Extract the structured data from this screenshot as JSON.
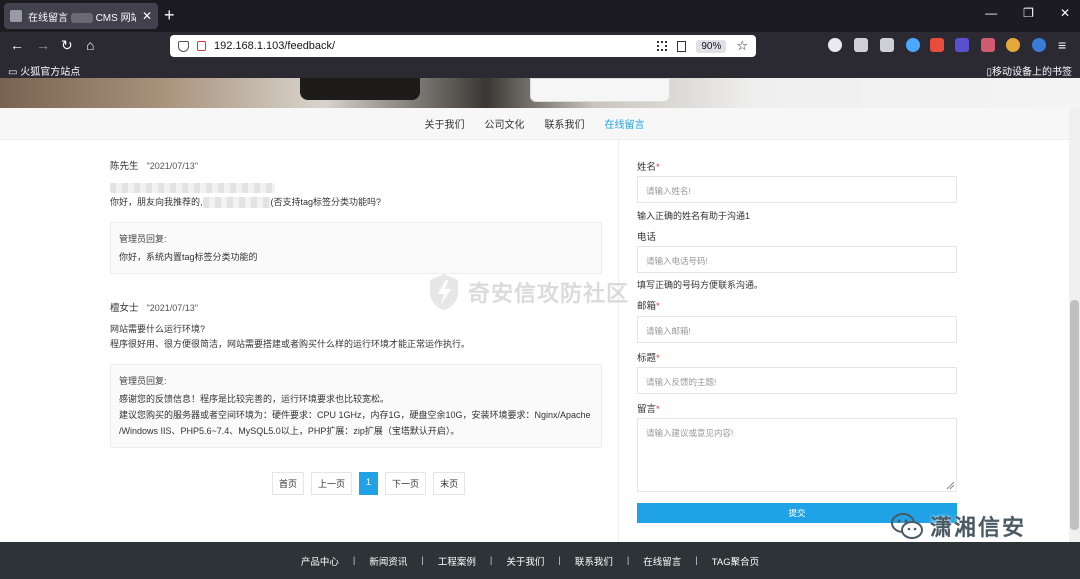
{
  "browser": {
    "tab_title": "在线留言",
    "tab_title_rest": "CMS 网站管理",
    "url": "192.168.1.103/feedback/",
    "zoom": "90%",
    "bookmark_left": "火狐官方站点",
    "bookmark_right": "移动设备上的书签"
  },
  "nav": {
    "items": [
      {
        "label": "关于我们"
      },
      {
        "label": "公司文化"
      },
      {
        "label": "联系我们"
      },
      {
        "label": "在线留言"
      }
    ],
    "active_color": "#1fa2e6"
  },
  "messages": [
    {
      "name": "陈先生",
      "date": "\"2021/07/13\"",
      "text_before": "你好，朋友向我推荐的,",
      "text_after": "(否支持tag标签分类功能吗?",
      "reply_label": "管理员回复:",
      "reply_lines": [
        "你好，系统内置tag标签分类功能的"
      ]
    },
    {
      "name": "檀女士",
      "date": "\"2021/07/13\"",
      "text_lines": [
        "网站需要什么运行环境?",
        "程序很好用、很方便很简洁，网站需要搭建或者购买什么样的运行环境才能正常运作执行。"
      ],
      "reply_label": "管理员回复:",
      "reply_lines": [
        "感谢您的反馈信息！程序是比较完善的，运行环境要求也比较宽松。",
        "建议您购买的服务器或者空间环境为：硬件要求：CPU 1GHz，内存1G，硬盘空余10G，安装环境要求：Nginx/Apache",
        "/Windows IIS、PHP5.6~7.4、MySQL5.0以上，PHP扩展：zip扩展（宝塔默认开启）。"
      ]
    }
  ],
  "pager": {
    "first": "首页",
    "prev": "上一页",
    "current": "1",
    "next": "下一页",
    "last": "末页"
  },
  "form": {
    "name_label": "姓名",
    "name_placeholder": "请输入姓名!",
    "name_help": "输入正确的姓名有助于沟通1",
    "phone_label": "电话",
    "phone_placeholder": "请输入电话号码!",
    "phone_help": "填写正确的号码方便联系沟通。",
    "email_label": "邮箱",
    "email_placeholder": "请输入邮箱!",
    "subject_label": "标题",
    "subject_placeholder": "请输入反馈的主题!",
    "message_label": "留言",
    "message_placeholder": "请输入建议或意见内容!",
    "required_mark": "*",
    "submit": "提交"
  },
  "watermark": "奇安信攻防社区",
  "brand": "潇湘信安",
  "footer": {
    "items": [
      {
        "label": "产品中心"
      },
      {
        "label": "新闻资讯"
      },
      {
        "label": "工程案例"
      },
      {
        "label": "关于我们"
      },
      {
        "label": "联系我们"
      },
      {
        "label": "在线留言"
      },
      {
        "label": "TAG聚合页"
      }
    ],
    "separator": "|"
  }
}
